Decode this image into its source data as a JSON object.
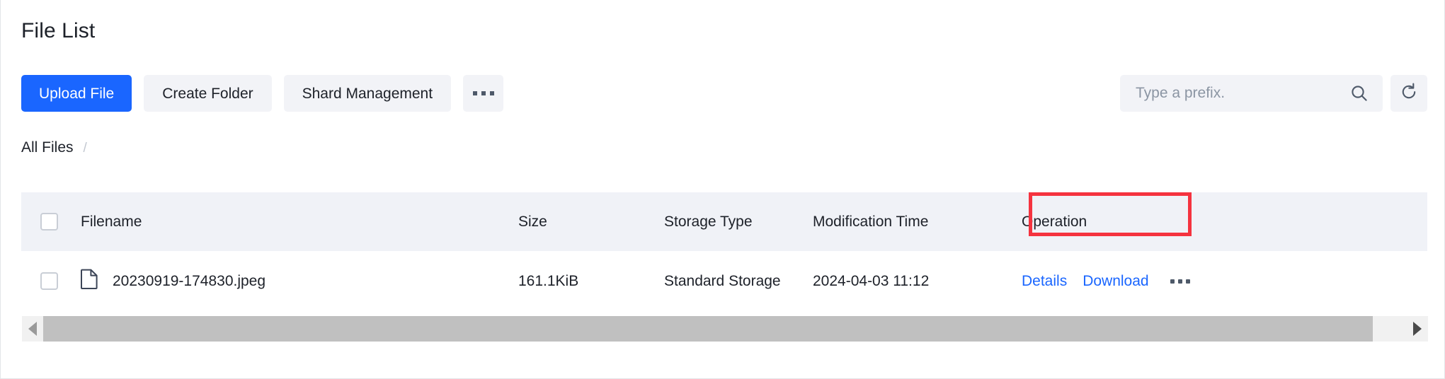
{
  "page": {
    "title": "File List"
  },
  "toolbar": {
    "upload_label": "Upload File",
    "create_folder_label": "Create Folder",
    "shard_management_label": "Shard Management",
    "more_label": "more-actions"
  },
  "search": {
    "placeholder": "Type a prefix.",
    "value": "",
    "icon": "search-icon",
    "refresh_icon": "refresh-icon"
  },
  "breadcrumb": {
    "items": [
      {
        "label": "All Files"
      }
    ],
    "separator": "/"
  },
  "table": {
    "columns": [
      {
        "key": "checkbox",
        "label": ""
      },
      {
        "key": "filename",
        "label": "Filename"
      },
      {
        "key": "size",
        "label": "Size"
      },
      {
        "key": "storage_type",
        "label": "Storage Type"
      },
      {
        "key": "modification_time",
        "label": "Modification Time"
      },
      {
        "key": "operation",
        "label": "Operation"
      }
    ],
    "highlighted_column": "Modification Time",
    "highlight_color": "#f5333f",
    "rows": [
      {
        "filename": "20230919-174830.jpeg",
        "file_icon": "document-icon",
        "size": "161.1KiB",
        "storage_type": "Standard Storage",
        "modification_time": "2024-04-03 11:12",
        "operations": {
          "details_label": "Details",
          "download_label": "Download",
          "more_label": "more-row-actions"
        }
      }
    ]
  },
  "scrollbar": {
    "orientation": "horizontal",
    "left_arrow": "triangle-left-icon",
    "right_arrow": "triangle-right-icon"
  },
  "colors": {
    "primary": "#1a66ff",
    "link": "#1a66ff",
    "header_bg": "#f0f2f7",
    "button_bg": "#f2f3f7",
    "text": "#1d2129",
    "highlight": "#f5333f"
  }
}
